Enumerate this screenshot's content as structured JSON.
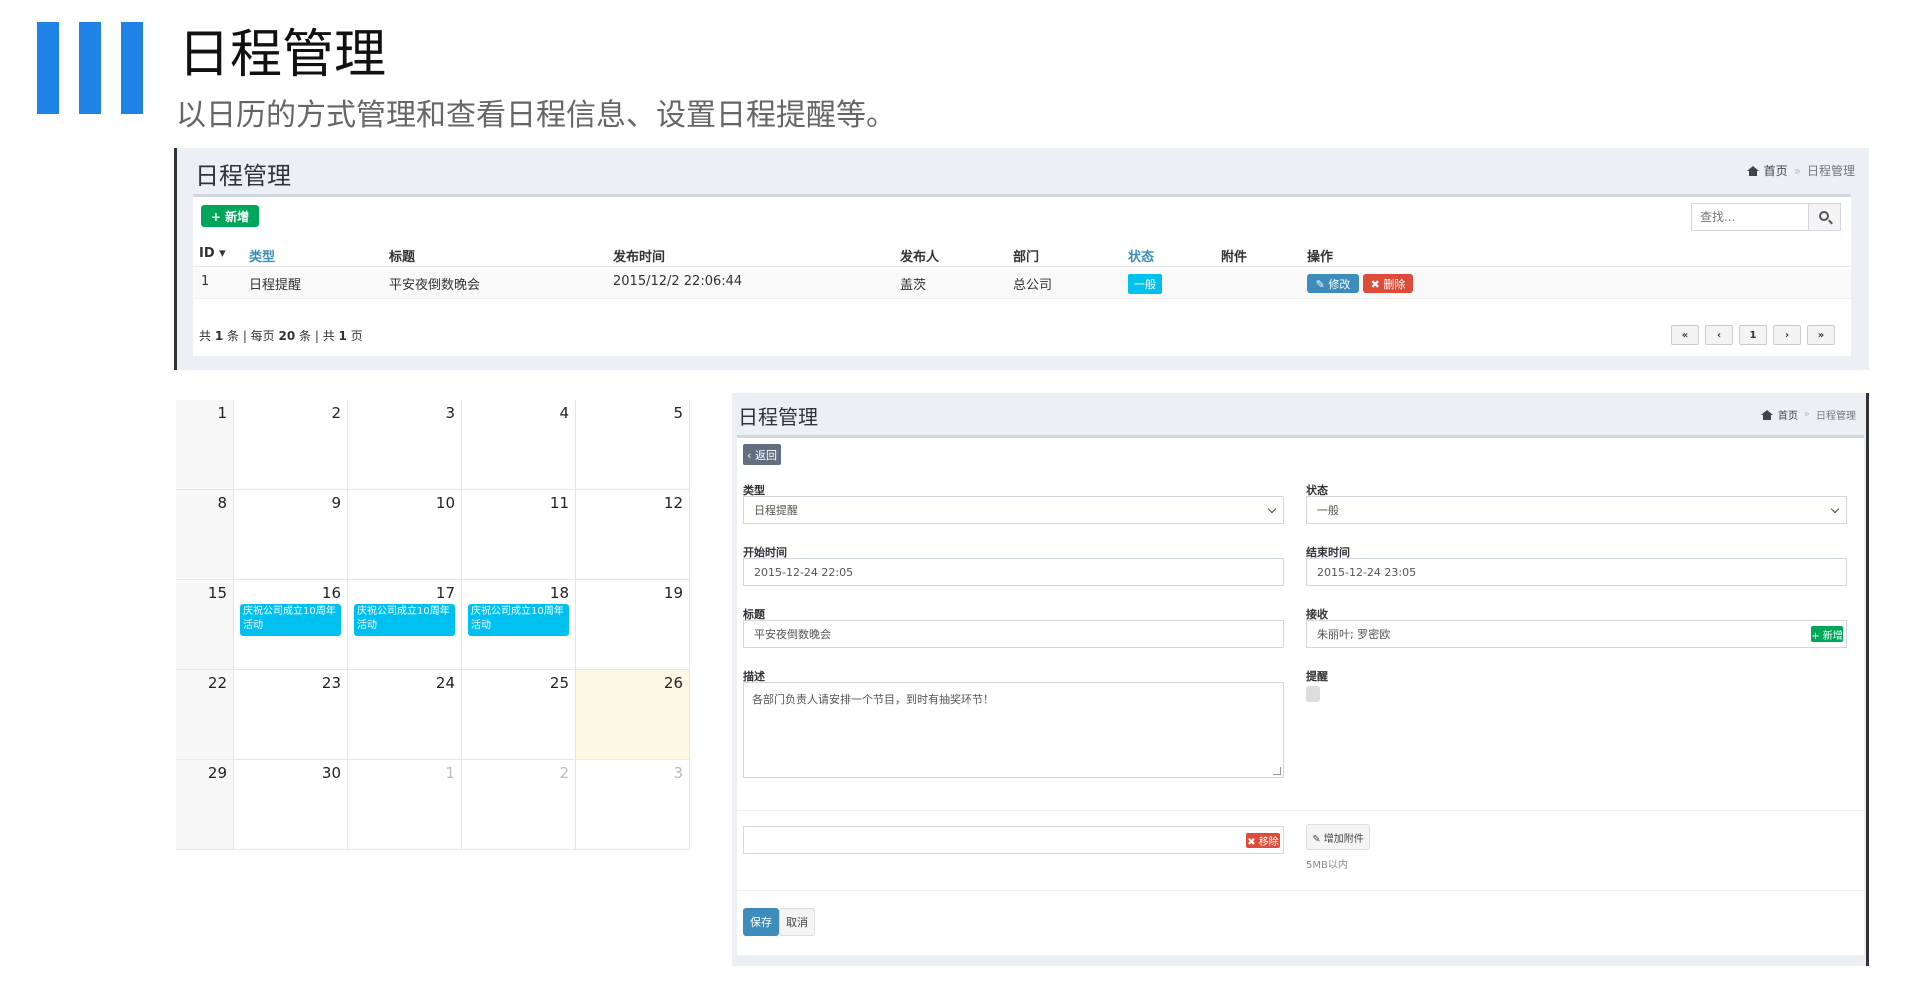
{
  "hero": {
    "title": "日程管理",
    "subtitle": "以日历的方式管理和查看日程信息、设置日程提醒等。"
  },
  "colors": {
    "accent": "#1e82e6",
    "green": "#00a65a",
    "blue": "#3c8dbc",
    "red": "#dd4b39",
    "cyan": "#00c0ef"
  },
  "list_panel": {
    "title": "日程管理",
    "breadcrumb": {
      "home": "首页",
      "sep": "»",
      "current": "日程管理"
    },
    "add_button": "+ 新增",
    "search_placeholder": "查找...",
    "columns": [
      "ID ▾",
      "类型",
      "标题",
      "发布时间",
      "发布人",
      "部门",
      "状态",
      "附件",
      "操作"
    ],
    "rows": [
      {
        "id": "1",
        "type": "日程提醒",
        "title": "平安夜倒数晚会",
        "time": "2015/12/2 22:06:44",
        "publisher": "盖茨",
        "dept": "总公司",
        "status": "一般",
        "attachment": "",
        "edit": "✎ 修改",
        "delete": "✖ 删除"
      }
    ],
    "footer": {
      "p1": "共 ",
      "total": "1",
      "p2": " 条 | 每页 ",
      "per_page": "20",
      "p3": " 条 | 共 ",
      "pages": "1",
      "p4": " 页"
    },
    "pager": [
      "«",
      "‹",
      "1",
      "›",
      "»"
    ]
  },
  "calendar": {
    "weeks": [
      [
        {
          "d": "1"
        },
        {
          "d": "2"
        },
        {
          "d": "3"
        },
        {
          "d": "4"
        },
        {
          "d": "5"
        }
      ],
      [
        {
          "d": "8"
        },
        {
          "d": "9"
        },
        {
          "d": "10"
        },
        {
          "d": "11"
        },
        {
          "d": "12"
        }
      ],
      [
        {
          "d": "15"
        },
        {
          "d": "16",
          "event": "庆祝公司成立10周年活动"
        },
        {
          "d": "17",
          "event": "庆祝公司成立10周年活动"
        },
        {
          "d": "18",
          "event": "庆祝公司成立10周年活动"
        },
        {
          "d": "19"
        }
      ],
      [
        {
          "d": "22"
        },
        {
          "d": "23"
        },
        {
          "d": "24"
        },
        {
          "d": "25"
        },
        {
          "d": "26",
          "today": true
        }
      ],
      [
        {
          "d": "29"
        },
        {
          "d": "30"
        },
        {
          "d": "1",
          "other": true
        },
        {
          "d": "2",
          "other": true
        },
        {
          "d": "3",
          "other": true
        }
      ]
    ]
  },
  "form_panel": {
    "title": "日程管理",
    "breadcrumb": {
      "home": "首页",
      "sep": "»",
      "current": "日程管理"
    },
    "back_button": "‹ 返回",
    "fields": {
      "type": {
        "label": "类型",
        "value": "日程提醒"
      },
      "status": {
        "label": "状态",
        "value": "一般"
      },
      "start": {
        "label": "开始时间",
        "value": "2015-12-24 22:05"
      },
      "end": {
        "label": "结束时间",
        "value": "2015-12-24 23:05"
      },
      "title": {
        "label": "标题",
        "value": "平安夜倒数晚会"
      },
      "receiver": {
        "label": "接收",
        "value": "朱丽叶; 罗密欧",
        "add": "+ 新增"
      },
      "desc": {
        "label": "描述",
        "value": "各部门负责人请安排一个节目，到时有抽奖环节！"
      },
      "remind": {
        "label": "提醒"
      }
    },
    "attach": {
      "remove": "✖ 移除",
      "add": "✎ 增加附件",
      "hint": "5MB以内"
    },
    "save": "保存",
    "cancel": "取消"
  }
}
